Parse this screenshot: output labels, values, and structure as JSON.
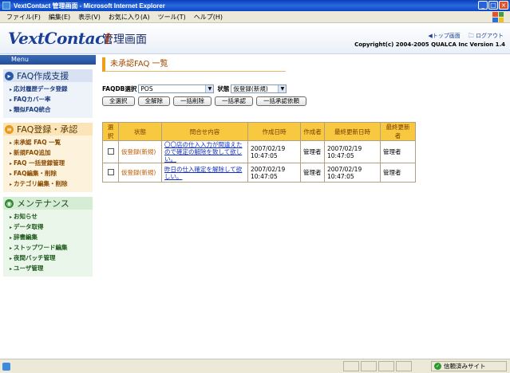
{
  "window": {
    "title": "VextContact 管理画面 - Microsoft Internet Explorer",
    "menu": [
      "ファイル(F)",
      "編集(E)",
      "表示(V)",
      "お気に入り(A)",
      "ツール(T)",
      "ヘルプ(H)"
    ]
  },
  "header": {
    "logo_main": "VextContac",
    "logo_end": "t",
    "page_title": "管理画面",
    "link_top": "◀トップ画面",
    "link_logout": "🗀 ログアウト",
    "copyright": "Copyright(c) 2004-2005 QUALCA Inc Version 1.4"
  },
  "sidebar": {
    "menu_label": "Menu",
    "sections": [
      {
        "title": "FAQ作成支援",
        "items": [
          "応対履歴データ登録",
          "FAQカバー率",
          "類似FAQ統合"
        ]
      },
      {
        "title": "FAQ登録・承認",
        "items": [
          "未承認 FAQ 一覧",
          "新規FAQ追加",
          "FAQ 一括登録管理",
          "FAQ編集・削除",
          "カテゴリ編集・削除"
        ]
      },
      {
        "title": "メンテナンス",
        "items": [
          "お知らせ",
          "データ取得",
          "辞書編集",
          "ストップワード編集",
          "夜間バッチ管理",
          "ユーザ管理"
        ]
      }
    ]
  },
  "main": {
    "section_title": "未承認FAQ 一覧",
    "filters": {
      "db_label": "FAQDB選択",
      "db_value": "POS",
      "status_label": "状態",
      "status_value": "仮登録(新規)"
    },
    "buttons": [
      "全選択",
      "全解除",
      "一括削除",
      "一括承認",
      "一括承認依頼"
    ],
    "table": {
      "headers": [
        "選択",
        "状態",
        "問合せ内容",
        "作成日時",
        "作成者",
        "最終更新日時",
        "最終更新者"
      ],
      "rows": [
        {
          "status": "仮登録(新規)",
          "content": "〇〇店の仕入入力が間違えたので確定の解除を致して欲しい。",
          "created": "2007/02/19 10:47:05",
          "creator": "管理者",
          "updated": "2007/02/19 10:47:05",
          "updater": "管理者"
        },
        {
          "status": "仮登録(新規)",
          "content": "昨日の仕入確定を解除して欲しい。",
          "created": "2007/02/19 10:47:05",
          "creator": "管理者",
          "updated": "2007/02/19 10:47:05",
          "updater": "管理者"
        }
      ]
    }
  },
  "statusbar": {
    "zone": "信頼済みサイト"
  }
}
